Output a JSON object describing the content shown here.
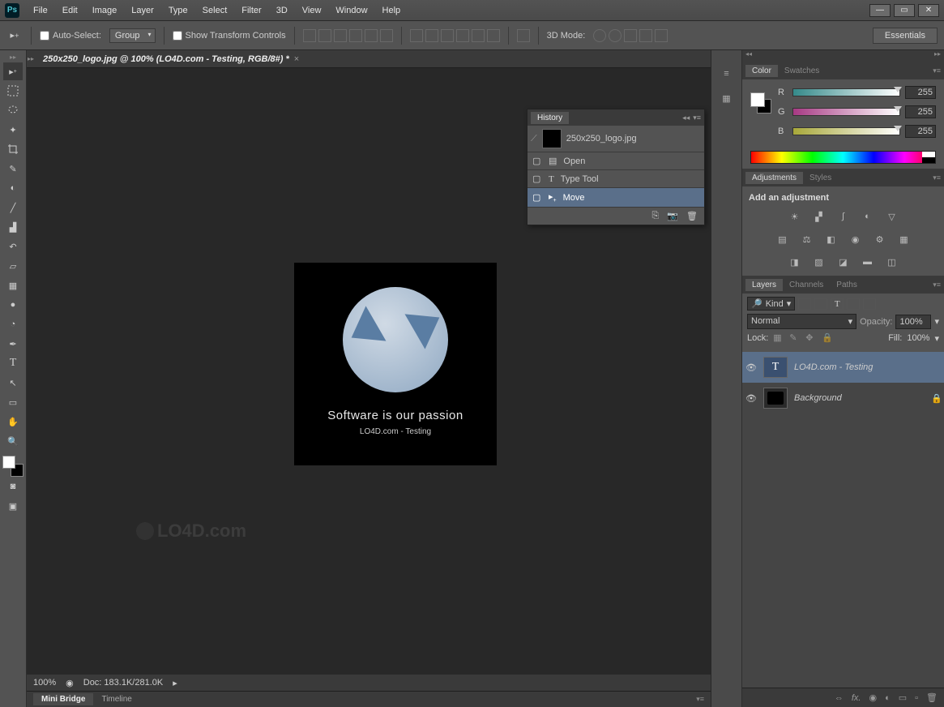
{
  "app": {
    "logo": "Ps"
  },
  "menu": [
    "File",
    "Edit",
    "Image",
    "Layer",
    "Type",
    "Select",
    "Filter",
    "3D",
    "View",
    "Window",
    "Help"
  ],
  "optbar": {
    "auto_select": "Auto-Select:",
    "group": "Group",
    "show_transform": "Show Transform Controls",
    "mode_3d": "3D Mode:",
    "workspace": "Essentials"
  },
  "doc": {
    "tab": "250x250_logo.jpg @ 100% (LO4D.com - Testing, RGB/8#) *",
    "canvas": {
      "tagline": "Software is our passion",
      "subline": "LO4D.com - Testing"
    },
    "status_zoom": "100%",
    "status_doc": "Doc: 183.1K/281.0K"
  },
  "bottom_tabs": {
    "mini_bridge": "Mini Bridge",
    "timeline": "Timeline"
  },
  "watermark": "LO4D.com",
  "history": {
    "title": "History",
    "file": "250x250_logo.jpg",
    "items": [
      {
        "icon": "open",
        "label": "Open"
      },
      {
        "icon": "type",
        "label": "Type Tool"
      },
      {
        "icon": "move",
        "label": "Move"
      }
    ]
  },
  "color": {
    "tabs": [
      "Color",
      "Swatches"
    ],
    "r": {
      "label": "R",
      "value": "255"
    },
    "g": {
      "label": "G",
      "value": "255"
    },
    "b": {
      "label": "B",
      "value": "255"
    }
  },
  "adjustments": {
    "tabs": [
      "Adjustments",
      "Styles"
    ],
    "title": "Add an adjustment"
  },
  "layers": {
    "tabs": [
      "Layers",
      "Channels",
      "Paths"
    ],
    "kind": "Kind",
    "blend": "Normal",
    "opacity_lbl": "Opacity:",
    "opacity_val": "100%",
    "lock_lbl": "Lock:",
    "fill_lbl": "Fill:",
    "fill_val": "100%",
    "items": [
      {
        "type": "T",
        "name": "LO4D.com - Testing",
        "locked": false
      },
      {
        "type": "img",
        "name": "Background",
        "locked": true
      }
    ]
  }
}
